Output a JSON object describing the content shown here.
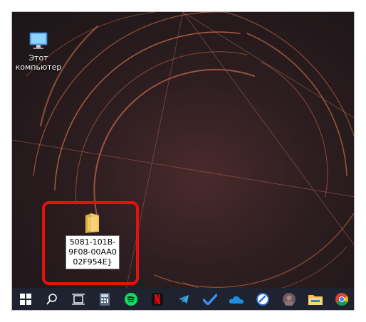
{
  "desktop": {
    "icons": [
      {
        "name": "this-pc",
        "label": "Этот компьютер"
      }
    ],
    "folder": {
      "label": "5081-101B-9F08-00AA002F954E}"
    }
  },
  "taskbar": {
    "items": [
      {
        "name": "start",
        "icon": "windows-logo-icon"
      },
      {
        "name": "search",
        "icon": "search-icon"
      },
      {
        "name": "task-view",
        "icon": "task-view-icon"
      },
      {
        "name": "calculator",
        "icon": "calculator-icon"
      },
      {
        "name": "spotify",
        "icon": "spotify-icon"
      },
      {
        "name": "netflix",
        "icon": "netflix-icon"
      },
      {
        "name": "telegram",
        "icon": "telegram-icon"
      },
      {
        "name": "todo",
        "icon": "checkmark-icon"
      },
      {
        "name": "onedrive",
        "icon": "cloud-icon"
      },
      {
        "name": "app",
        "icon": "app-icon"
      },
      {
        "name": "photo",
        "icon": "avatar-icon"
      },
      {
        "name": "explorer",
        "icon": "folder-icon"
      },
      {
        "name": "chrome",
        "icon": "chrome-icon"
      }
    ]
  },
  "colors": {
    "highlight": "#e8100f",
    "taskbar": "#1f2330",
    "accent_arcs": "#c96a4a"
  }
}
